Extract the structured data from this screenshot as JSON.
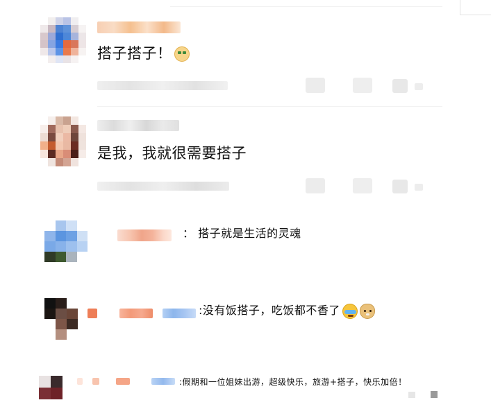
{
  "comments": [
    {
      "text": "搭子搭子！",
      "reaction_icon": "money-face-emoji-icon",
      "accent_colors": [
        "#f7c79a",
        "#f5d3b1",
        "#fbe2cb"
      ]
    },
    {
      "text": "是我，我就很需要搭子",
      "reaction_icon": null,
      "accent_colors": [
        "#d8d8d8",
        "#e6e6e6"
      ]
    },
    {
      "separator": "：",
      "text": "搭子就是生活的灵魂",
      "reaction_icon": null
    },
    {
      "separator": ":",
      "text": "没有饭搭子，吃饭都不香了",
      "reaction_icons": [
        "crying-laughing-emoji-icon",
        "doge-emoji-icon"
      ]
    },
    {
      "separator": ":",
      "text": "假期和一位姐妹出游，超级快乐，旅游+搭子，快乐加倍！",
      "reaction_icon": null
    }
  ],
  "palette": {
    "redacted_orange": "#f4a57f",
    "redacted_blue": "#9cc1f0",
    "redacted_gray": "#e6e6e6",
    "divider": "#f2f2f2"
  }
}
